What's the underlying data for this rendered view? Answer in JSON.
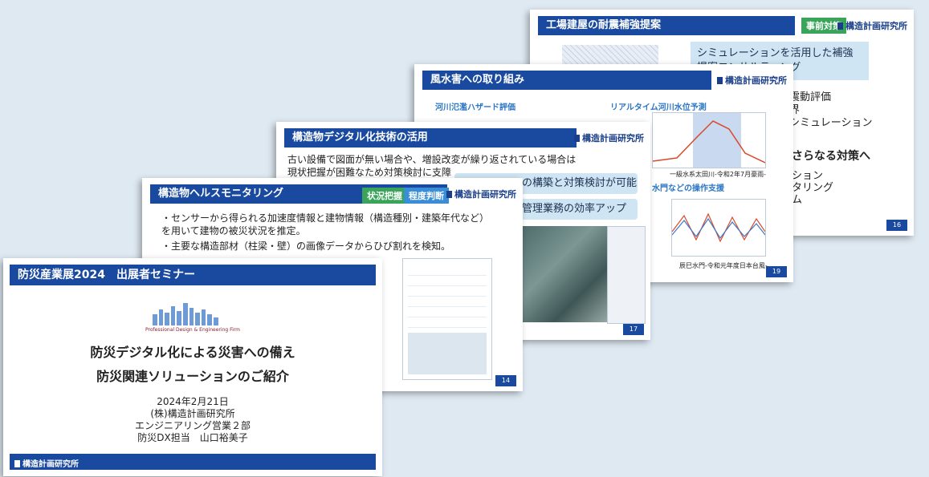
{
  "slide16": {
    "title": "工場建屋の耐震補強提案",
    "tag": "事前対策",
    "logo": "構造計画研究所",
    "box": "シミュレーションを活用した補強提案コンサルティング",
    "b1": "地震動評価",
    "b2": "限界",
    "b3": "るシミュレーション",
    "b4": "さらなる対策へ",
    "b5": "ション",
    "b6": "タリング",
    "b7": "ム",
    "page": "16"
  },
  "slide19": {
    "title": "風水害への取り組み",
    "logo": "構造計画研究所",
    "left_label": "河川氾濫ハザード評価",
    "right_label": "リアルタイム河川水位予測",
    "caption1": "一級水系太田川-令和2年7月豪雨-",
    "caption2": "水門などの操作支援",
    "caption3": "辰巳水門-令和元年度日本台風-",
    "page": "19"
  },
  "slide17": {
    "title": "構造物デジタル化技術の活用",
    "logo": "構造計画研究所",
    "line1": "古い設備で図面が無い場合や、増設改変が繰り返されている場合は",
    "line2": "現状把握が困難なため対策検討に支障",
    "box1": "の構築と対策検討が可能に",
    "box2": "管理業務の効率アップ",
    "page": "17"
  },
  "slide14": {
    "title": "構造物ヘルスモニタリング",
    "tag1": "状況把握",
    "tag2": "程度判断",
    "logo": "構造計画研究所",
    "bullet1": "センサーから得られる加速度情報と建物情報（構造種別・建築年代など）を用いて建物の被災状況を推定。",
    "bullet2": "主要な構造部材（柱梁・壁）の画像データからひび割れを検知。",
    "page": "14"
  },
  "cover": {
    "header": "防災産業展2024　出展者セミナー",
    "tagline": "Professional Design & Engineering Firm",
    "title1": "防災デジタル化による災害への備え",
    "title2": "防災関連ソリューションのご紹介",
    "date": "2024年2月21日",
    "company": "(株)構造計画研究所",
    "dept": "エンジニアリング営業２部",
    "person": "防災DX担当　山口裕美子",
    "footer_logo": "構造計画研究所"
  },
  "colors": {
    "accent": "#1a4aa0",
    "green": "#3aa45a",
    "light_blue": "#cfe5f3"
  }
}
